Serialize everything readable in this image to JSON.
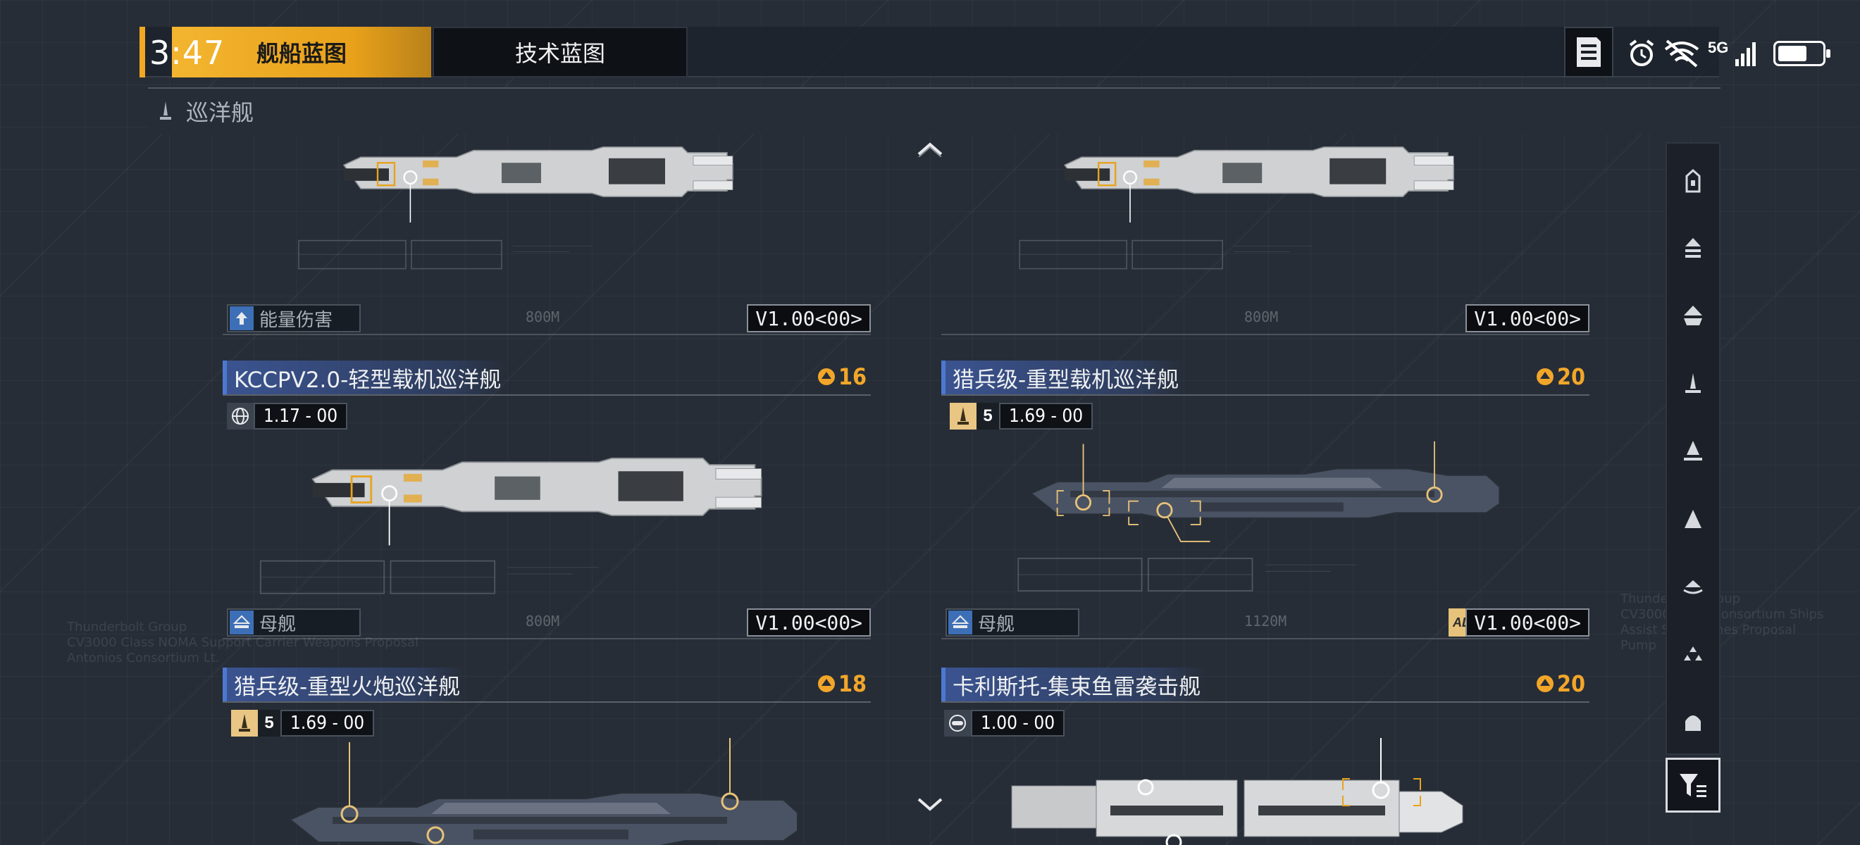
{
  "status_bar": {
    "time": "3:47",
    "network": "5G"
  },
  "tabs": [
    {
      "label": "舰船蓝图",
      "active": true
    },
    {
      "label": "技术蓝图",
      "active": false
    }
  ],
  "breadcrumb": {
    "label": "巡洋舰"
  },
  "colors": {
    "accent": "#f1a823",
    "name_bar": "#3e5aa0",
    "cost": "#f2a629"
  },
  "cards": [
    {
      "name": "",
      "cost": "",
      "meta_version": "",
      "tag": "能量伤害",
      "tag_icon": "arrow-up-icon",
      "version": "V1.00<00>",
      "scale": "800M",
      "ship_style": "light"
    },
    {
      "name": "",
      "cost": "",
      "meta_version": "",
      "tag": "",
      "version": "V1.00<00>",
      "scale": "800M",
      "ship_style": "light"
    },
    {
      "name": "KCCPV2.0-轻型载机巡洋舰",
      "cost": "16",
      "meta_icon": "globe-icon",
      "meta_version": "1.17 - 00",
      "tag": "母舰",
      "tag_icon": "carrier-icon",
      "version": "V1.00<00>",
      "scale": "800M",
      "ship_style": "light"
    },
    {
      "name": "猎兵级-重型载机巡洋舰",
      "cost": "20",
      "meta_icon": "cruiser-icon",
      "tier": "5",
      "meta_version": "1.69 - 00",
      "tag": "母舰",
      "tag_icon": "carrier-icon",
      "version": "V1.00<00>",
      "adv": "ADV",
      "scale": "1120M",
      "ship_style": "dark"
    },
    {
      "name": "猎兵级-重型火炮巡洋舰",
      "cost": "18",
      "meta_icon": "cruiser-icon",
      "tier": "5",
      "meta_version": "1.69 - 00",
      "ship_style": "dark"
    },
    {
      "name": "卡利斯托-集束鱼雷袭击舰",
      "cost": "20",
      "meta_icon": "torpedo-icon",
      "meta_version": "1.00 - 00",
      "ship_style": "light"
    }
  ],
  "rail": [
    {
      "icon": "frigate-icon"
    },
    {
      "icon": "destroyer-icon"
    },
    {
      "icon": "cruiser-class-icon"
    },
    {
      "icon": "battlecruiser-icon"
    },
    {
      "icon": "battleship-icon"
    },
    {
      "icon": "auxiliary-icon"
    },
    {
      "icon": "carrier-class-icon"
    },
    {
      "icon": "corvette-icon"
    },
    {
      "icon": "station-icon"
    }
  ],
  "background_text": {
    "left": [
      "Thunderbolt Group",
      "CV3000 Class NOMA Support Carrier Weapons Proposal",
      "Antonios Consortium Lt."
    ],
    "right": [
      "Thunderbolt Group",
      "CV3000-Class Consortium Ships",
      "Assist Ship Drones Proposal",
      "Pump"
    ]
  }
}
